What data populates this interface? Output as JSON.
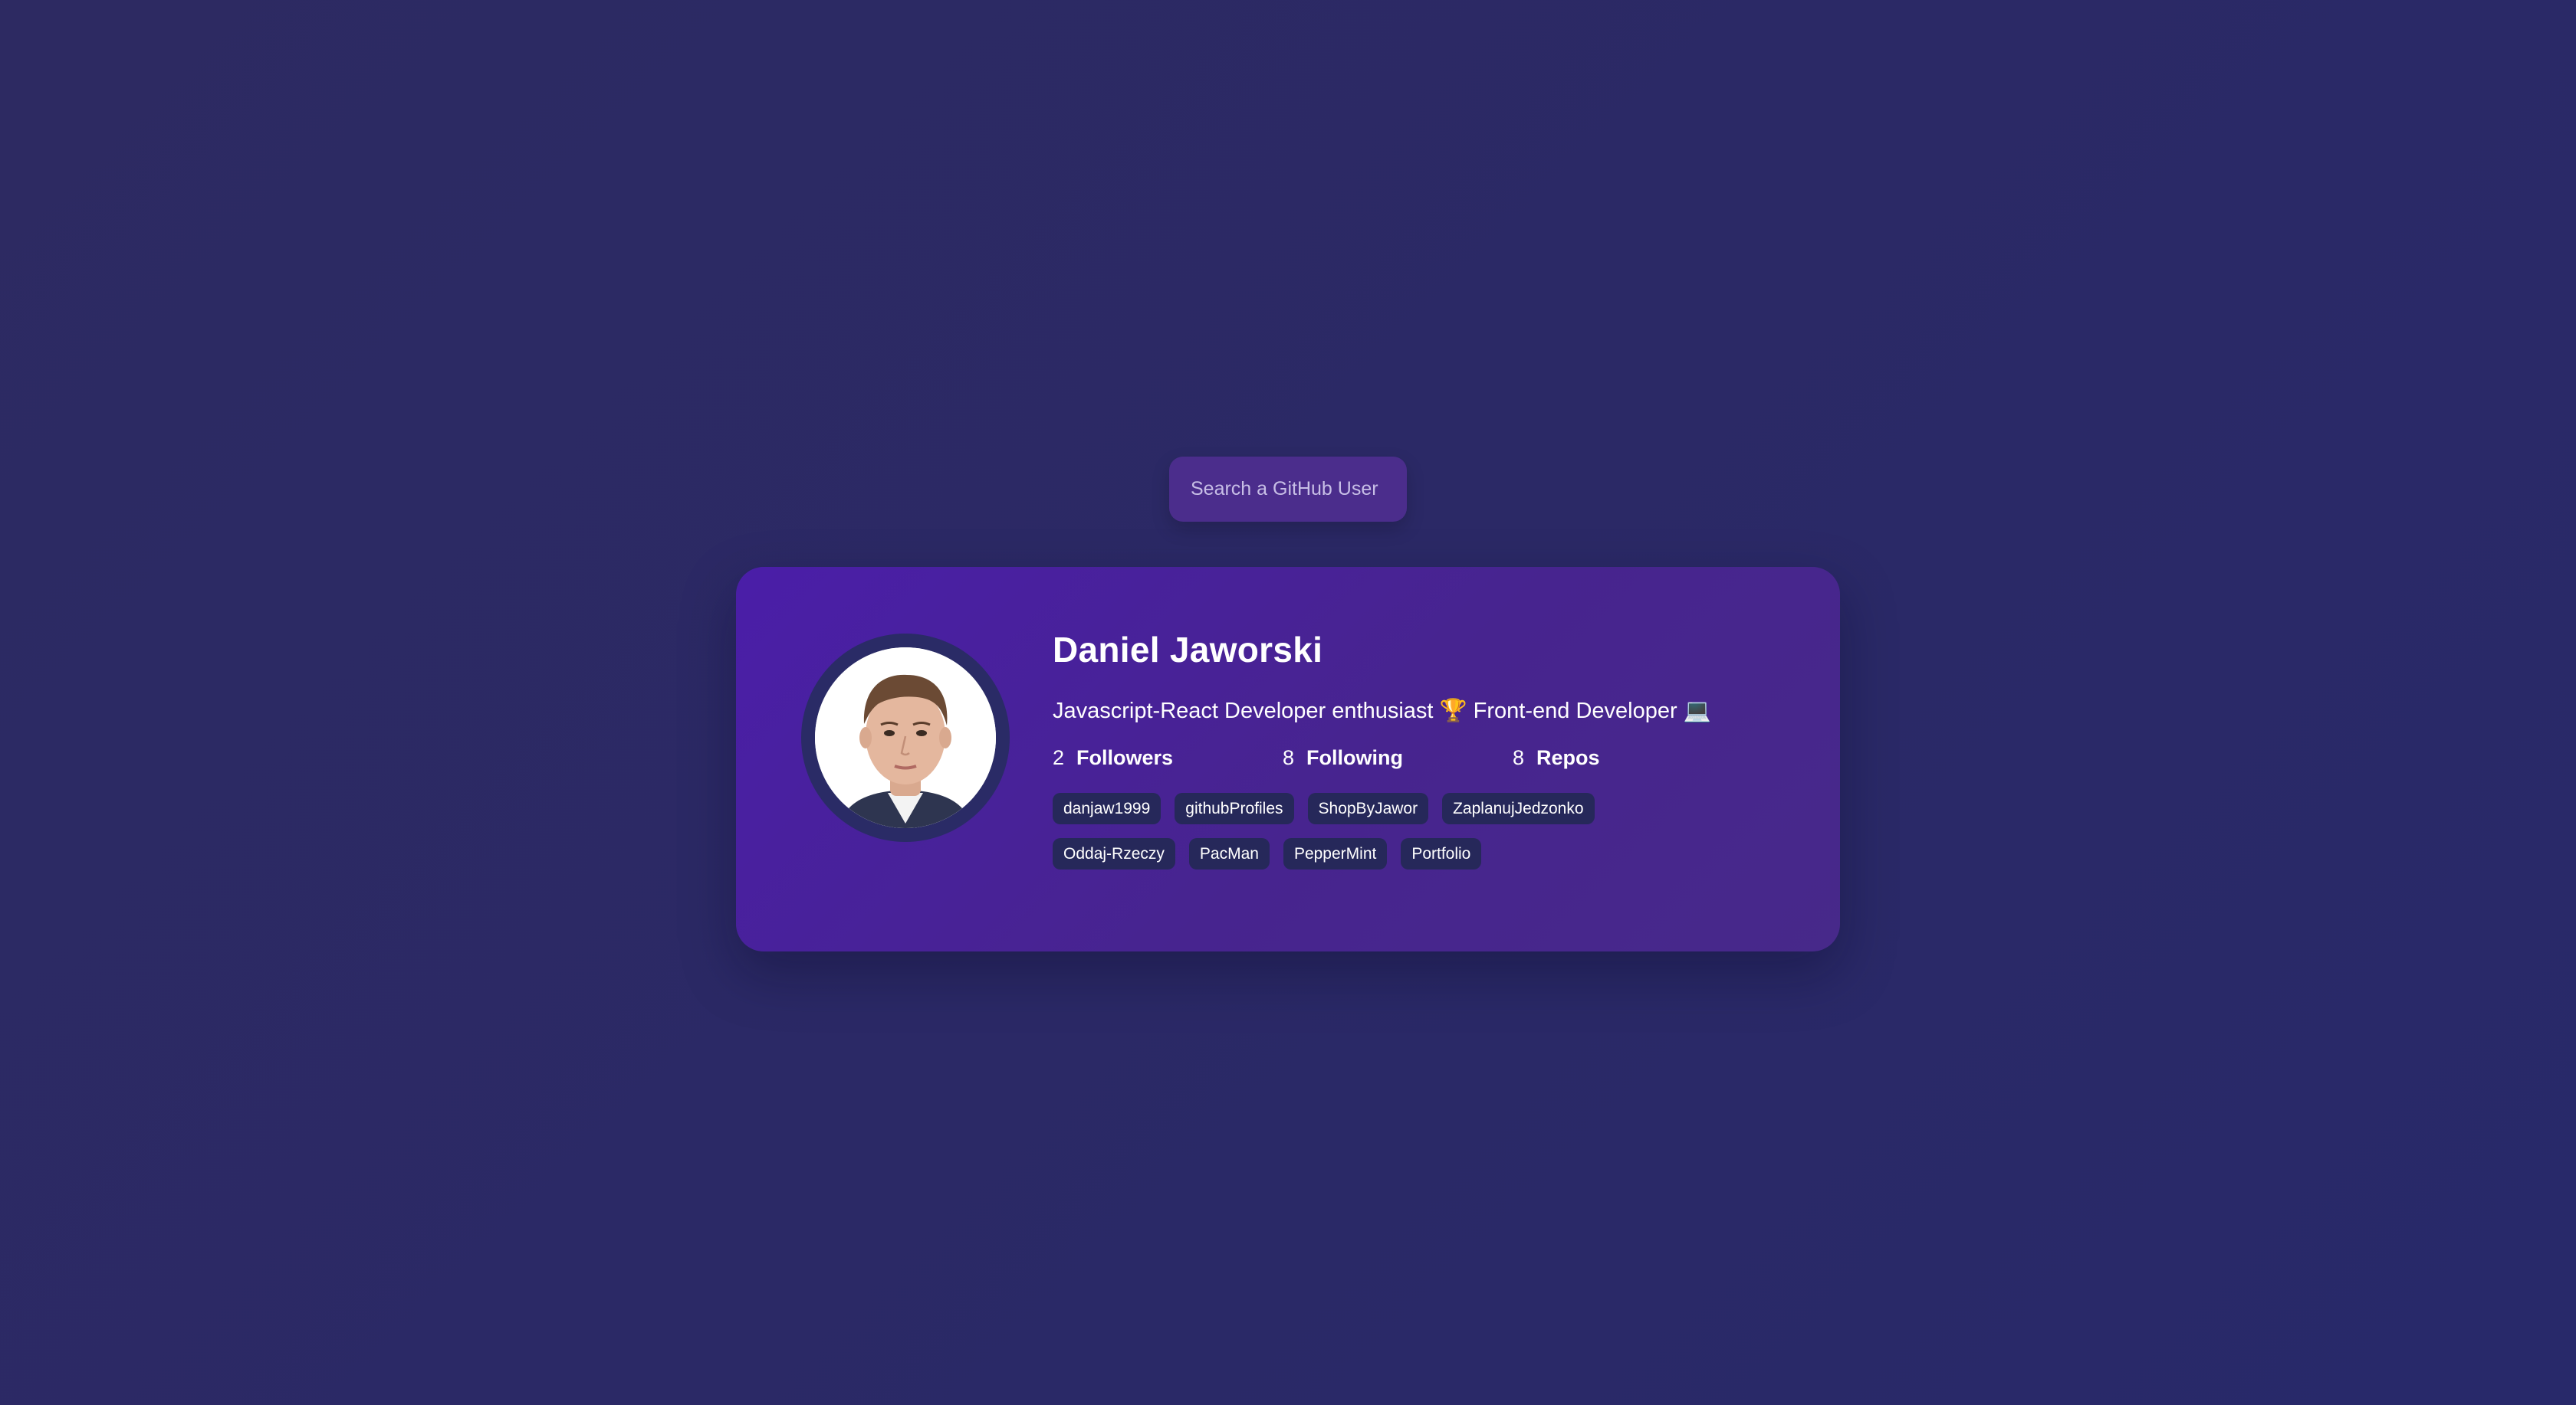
{
  "search": {
    "placeholder": "Search a GitHub User",
    "value": ""
  },
  "profile": {
    "name": "Daniel Jaworski",
    "bio": "Javascript-React Developer enthusiast 🏆  Front-end Developer 💻",
    "stats": [
      {
        "value": "2",
        "label": "Followers"
      },
      {
        "value": "8",
        "label": "Following"
      },
      {
        "value": "8",
        "label": "Repos"
      }
    ],
    "repos": [
      "danjaw1999",
      "githubProfiles",
      "ShopByJawor",
      "ZaplanujJedzonko",
      "Oddaj-Rzeczy",
      "PacMan",
      "PepperMint",
      "Portfolio"
    ]
  },
  "colors": {
    "background": "#2b2966",
    "card": "#4a1ea8",
    "search": "#4b2d8c",
    "repo_tag": "#26285a",
    "avatar_ring": "#2a2b66"
  }
}
